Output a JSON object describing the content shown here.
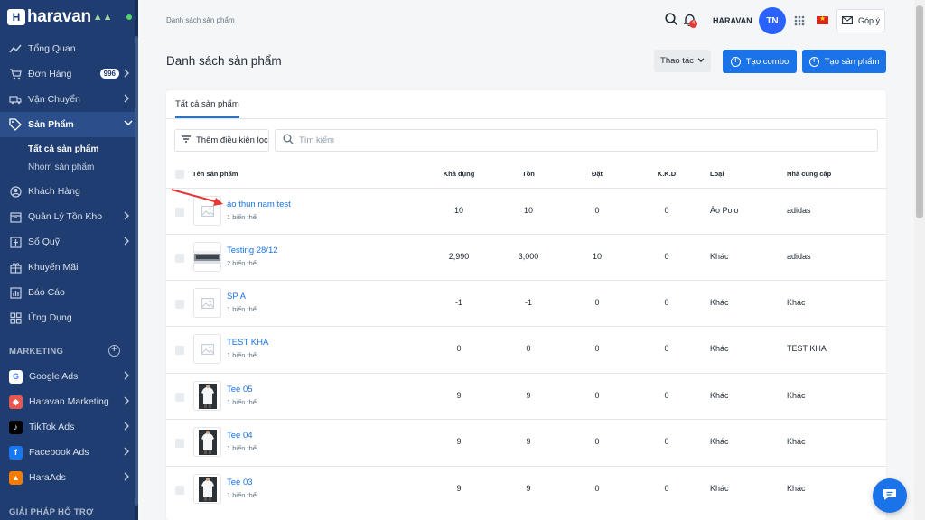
{
  "brand": {
    "name": "haravan",
    "logo_letter": "H"
  },
  "sidebar": {
    "items": [
      {
        "label": "Tổng Quan",
        "icon": "trend-icon"
      },
      {
        "label": "Đơn Hàng",
        "icon": "cart-icon",
        "badge": "996"
      },
      {
        "label": "Vận Chuyển",
        "icon": "truck-icon"
      },
      {
        "label": "Sản Phẩm",
        "icon": "tag-icon"
      },
      {
        "label": "Khách Hàng",
        "icon": "user-icon"
      },
      {
        "label": "Quản Lý Tồn Kho",
        "icon": "inventory-icon"
      },
      {
        "label": "Sổ Quỹ",
        "icon": "cashbook-icon"
      },
      {
        "label": "Khuyến Mãi",
        "icon": "gift-icon"
      },
      {
        "label": "Báo Cáo",
        "icon": "report-icon"
      },
      {
        "label": "Ứng Dụng",
        "icon": "apps-icon"
      }
    ],
    "subitems": [
      {
        "label": "Tất cả sản phẩm"
      },
      {
        "label": "Nhóm sản phẩm"
      }
    ],
    "marketing_title": "MARKETING",
    "marketing_items": [
      {
        "label": "Google Ads",
        "icon": "google-icon",
        "color": "#ffffff"
      },
      {
        "label": "Haravan Marketing",
        "icon": "haravan-marketing-icon",
        "color": "#e8574e"
      },
      {
        "label": "TikTok Ads",
        "icon": "tiktok-icon",
        "color": "#000000"
      },
      {
        "label": "Facebook Ads",
        "icon": "facebook-icon",
        "color": "#1877f2"
      },
      {
        "label": "HaraAds",
        "icon": "haraads-icon",
        "color": "#f57c00"
      }
    ],
    "support_title": "GIẢI PHÁP HỖ TRỢ"
  },
  "topbar": {
    "breadcrumb": "Danh sách sản phẩm",
    "notification_count": "4",
    "shop_name": "HARAVAN",
    "avatar_initials": "TN",
    "feedback_label": "Góp ý"
  },
  "header": {
    "title": "Danh sách sản phẩm",
    "actions_label": "Thao tác",
    "create_combo_label": "Tạo combo",
    "create_product_label": "Tạo sản phẩm"
  },
  "products": {
    "tab_label": "Tất cả sản phẩm",
    "filter_label": "Thêm điều kiện lọc",
    "search_placeholder": "Tìm kiếm",
    "columns": [
      "Tên sản phẩm",
      "Khả dụng",
      "Tồn",
      "Đặt",
      "K.K.D",
      "Loại",
      "Nhà cung cấp"
    ],
    "rows": [
      {
        "name": "áo thun nam test",
        "variants": "1 biến thể",
        "available": "10",
        "stock": "10",
        "ordered": "0",
        "kkd": "0",
        "type": "Áo Polo",
        "vendor": "adidas",
        "thumb": "placeholder"
      },
      {
        "name": "Testing 28/12",
        "variants": "2 biến thể",
        "available": "2,990",
        "stock": "3,000",
        "ordered": "10",
        "kkd": "0",
        "type": "Khác",
        "vendor": "adidas",
        "thumb": "photo"
      },
      {
        "name": "SP A",
        "variants": "1 biến thể",
        "available": "-1",
        "stock": "-1",
        "ordered": "0",
        "kkd": "0",
        "type": "Khác",
        "vendor": "Khác",
        "thumb": "placeholder"
      },
      {
        "name": "TEST KHA",
        "variants": "1 biến thể",
        "available": "0",
        "stock": "0",
        "ordered": "0",
        "kkd": "0",
        "type": "Khác",
        "vendor": "TEST KHA",
        "thumb": "placeholder"
      },
      {
        "name": "Tee 05",
        "variants": "1 biến thể",
        "available": "9",
        "stock": "9",
        "ordered": "0",
        "kkd": "0",
        "type": "Khác",
        "vendor": "Khác",
        "thumb": "tee"
      },
      {
        "name": "Tee 04",
        "variants": "1 biến thể",
        "available": "9",
        "stock": "9",
        "ordered": "0",
        "kkd": "0",
        "type": "Khác",
        "vendor": "Khác",
        "thumb": "tee"
      },
      {
        "name": "Tee 03",
        "variants": "1 biến thể",
        "available": "9",
        "stock": "9",
        "ordered": "0",
        "kkd": "0",
        "type": "Khác",
        "vendor": "Khác",
        "thumb": "tee"
      }
    ]
  },
  "colors": {
    "sidebar": "#1f3d70",
    "accent": "#1a73e8",
    "annotation_arrow": "#e53935"
  }
}
